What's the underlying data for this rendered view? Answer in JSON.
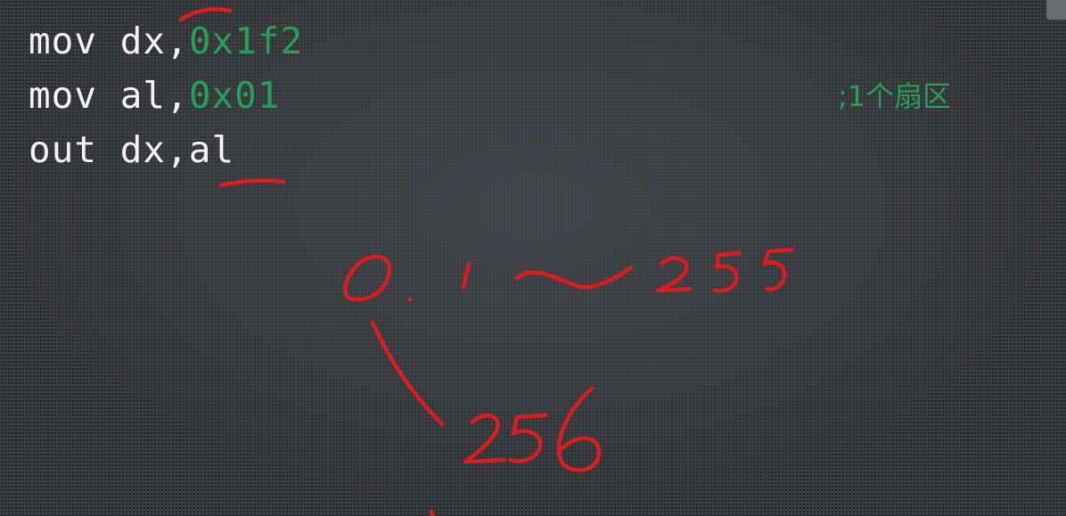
{
  "code": {
    "line1": {
      "instr": "mov",
      "reg": "dx,",
      "value": "0x1f2"
    },
    "line2": {
      "instr": "mov",
      "reg": "al,",
      "value": "0x01"
    },
    "line3": {
      "instr": "out",
      "reg": "dx,al"
    }
  },
  "comment": ";1个扇区",
  "colors": {
    "code_text": "#f2f2f2",
    "hex_value": "#27a055",
    "annotation_ink": "#d81e1e",
    "background": "#3a3c40"
  }
}
